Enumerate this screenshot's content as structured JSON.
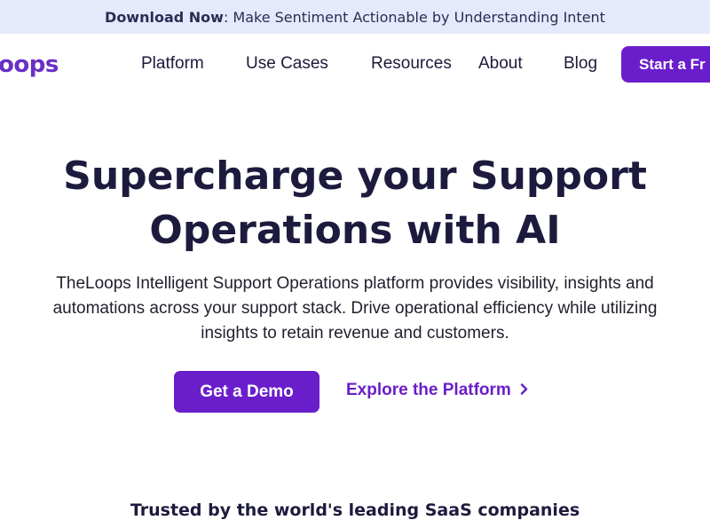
{
  "announcement": {
    "strong": "Download Now",
    "text": ": Make Sentiment Actionable by Understanding Intent"
  },
  "nav": {
    "logo": "oops",
    "items": [
      "Platform",
      "Use Cases",
      "Resources",
      "About",
      "Blog"
    ],
    "cta": "Start a Fr"
  },
  "hero": {
    "title_line1": "Supercharge your Support",
    "title_line2": "Operations with AI",
    "subtitle": "TheLoops Intelligent Support Operations platform provides visibility, insights and automations across your support stack. Drive operational efficiency while utilizing insights to retain revenue and customers.",
    "primary_button": "Get a Demo",
    "secondary_link": "Explore the Platform",
    "secondary_icon": "chevron-right-icon"
  },
  "trusted": {
    "heading": "Trusted by the world's leading SaaS companies"
  },
  "colors": {
    "accent": "#6a1ecb",
    "banner_bg": "#e4eafb",
    "heading": "#1d1b3d"
  }
}
